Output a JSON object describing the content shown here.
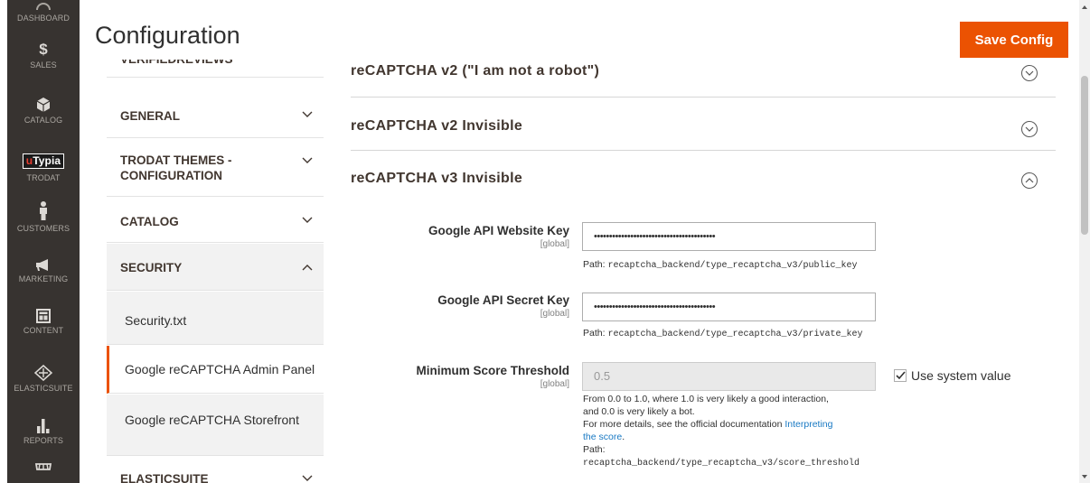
{
  "admin_nav": [
    {
      "name": "dashboard",
      "label": "DASHBOARD",
      "icon": "dashboard-icon"
    },
    {
      "name": "sales",
      "label": "SALES",
      "icon": "dollar-icon"
    },
    {
      "name": "catalog",
      "label": "CATALOG",
      "icon": "box-icon"
    },
    {
      "name": "trodat",
      "label": "TRODAT",
      "icon": "utypia-logo",
      "logo_text_u": "u",
      "logo_text_rest": "Typia"
    },
    {
      "name": "customers",
      "label": "CUSTOMERS",
      "icon": "person-icon"
    },
    {
      "name": "marketing",
      "label": "MARKETING",
      "icon": "megaphone-icon"
    },
    {
      "name": "content",
      "label": "CONTENT",
      "icon": "layout-icon"
    },
    {
      "name": "elasticsuite",
      "label": "ELASTICSUITE",
      "icon": "elasticsuite-icon"
    },
    {
      "name": "reports",
      "label": "REPORTS",
      "icon": "bar-chart-icon"
    },
    {
      "name": "stores",
      "label": "",
      "icon": "store-icon"
    }
  ],
  "header": {
    "title": "Configuration",
    "save_label": "Save Config"
  },
  "tabs": {
    "partial_top": "VERIFIEDREVIEWS",
    "items": [
      {
        "label": "GENERAL",
        "state": "collapsed"
      },
      {
        "label_line1": "TRODAT THEMES -",
        "label_line2": "CONFIGURATION",
        "state": "collapsed"
      },
      {
        "label": "CATALOG",
        "state": "collapsed"
      },
      {
        "label": "SECURITY",
        "state": "expanded"
      },
      {
        "label": "ELASTICSUITE",
        "state": "collapsed"
      }
    ],
    "security_subitems": [
      {
        "label": "Security.txt",
        "active": false
      },
      {
        "label": "Google reCAPTCHA Admin Panel",
        "active": true
      },
      {
        "label": "Google reCAPTCHA Storefront",
        "active": false
      }
    ]
  },
  "sections": [
    {
      "title": "reCAPTCHA v2 (\"I am not a robot\")",
      "state": "collapsed"
    },
    {
      "title": "reCAPTCHA v2 Invisible",
      "state": "collapsed"
    },
    {
      "title": "reCAPTCHA v3 Invisible",
      "state": "expanded"
    }
  ],
  "fields": {
    "website_key": {
      "label": "Google API Website Key",
      "scope": "[global]",
      "value": "••••••••••••••••••••••••••••••••••••••••",
      "path_prefix": "Path: ",
      "path": "recaptcha_backend/type_recaptcha_v3/public_key"
    },
    "secret_key": {
      "label": "Google API Secret Key",
      "scope": "[global]",
      "value": "••••••••••••••••••••••••••••••••••••••••",
      "path_prefix": "Path: ",
      "path": "recaptcha_backend/type_recaptcha_v3/private_key"
    },
    "score_threshold": {
      "label": "Minimum Score Threshold",
      "scope": "[global]",
      "value": "0.5",
      "use_system_value": "Use system value",
      "use_system_checked": true,
      "note_line1": "From 0.0 to 1.0, where 1.0 is very likely a good interaction,",
      "note_line2": "and 0.0 is very likely a bot.",
      "note_line3": "For more details, see the official documentation",
      "link_part1": "Interpreting",
      "link_part2": "the score",
      "link_after": ".",
      "path_label": "Path:",
      "path": "recaptcha_backend/type_recaptcha_v3/score_threshold"
    }
  },
  "colors": {
    "accent": "#eb5202",
    "nav_bg": "#373330",
    "link": "#1979c3"
  }
}
